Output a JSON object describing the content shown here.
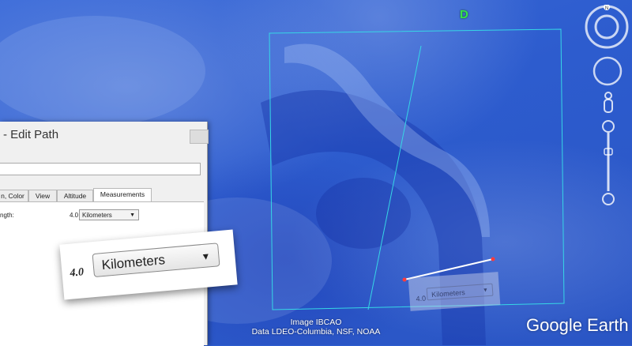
{
  "map": {
    "marker_label": "D",
    "attribution_line1": "Image IBCAO",
    "attribution_line2": "Data LDEO-Columbia, NSF, NOAA",
    "logo": "Google Earth",
    "compass_letter": "N"
  },
  "dialog": {
    "title": "- Edit Path",
    "name_value": "",
    "tabs": [
      {
        "label": "n, Color"
      },
      {
        "label": "View"
      },
      {
        "label": "Altitude"
      },
      {
        "label": "Measurements",
        "active": true
      }
    ],
    "length_label": "ngth:",
    "length_value": "4.0",
    "unit": "Kilometers"
  },
  "zoom_callout": {
    "value": "4.0",
    "unit": "Kilometers"
  },
  "mini_callout": {
    "value": "4.0",
    "unit": "Kilometers"
  },
  "colors": {
    "ocean": "#2f5fd0",
    "path_outline": "#36d7e6",
    "measure_line": "#ffffff",
    "endpoint": "#ff3b3b",
    "marker": "#37e24a"
  }
}
